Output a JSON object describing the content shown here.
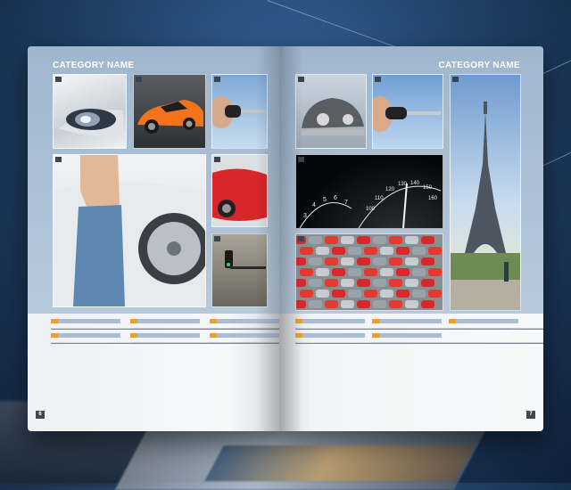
{
  "spread": {
    "left_page": {
      "category_label": "CATEGORY NAME",
      "page_number": "6",
      "photos": [
        {
          "icon": "headlight-photo"
        },
        {
          "icon": "orange-sports-car-photo"
        },
        {
          "icon": "car-key-photo"
        },
        {
          "icon": "woman-jeans-car-wheel-photo"
        },
        {
          "icon": "red-car-photo"
        },
        {
          "icon": "gear-shift-photo"
        }
      ]
    },
    "right_page": {
      "category_label": "CATEGORY NAME",
      "page_number": "7",
      "photos": [
        {
          "icon": "vintage-car-photo"
        },
        {
          "icon": "hand-holding-key-photo"
        },
        {
          "icon": "eiffel-tower-photo"
        },
        {
          "icon": "speedometer-photo"
        },
        {
          "icon": "parked-cars-photo"
        }
      ],
      "speedometer_ticks": [
        "3",
        "4",
        "5",
        "6",
        "7",
        "100",
        "110",
        "120",
        "130",
        "140",
        "150",
        "160"
      ]
    }
  },
  "colors": {
    "band": "#b0c4d8",
    "accent": "#f0a020",
    "text": "#7c848c"
  }
}
